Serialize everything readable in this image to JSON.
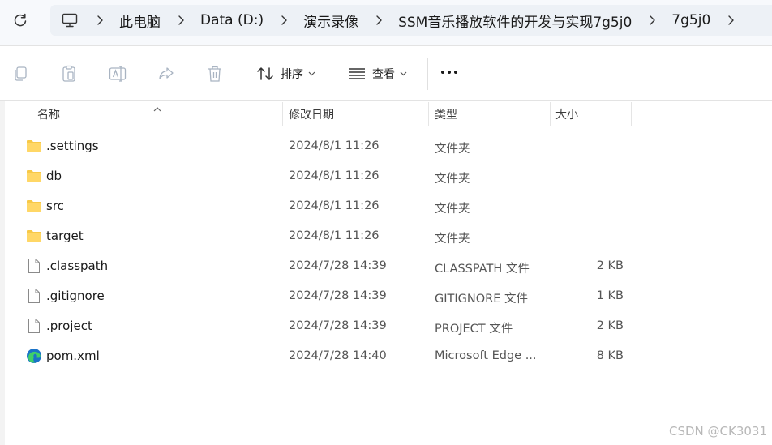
{
  "breadcrumb": {
    "items": [
      "此电脑",
      "Data (D:)",
      "演示录像",
      "SSM音乐播放软件的开发与实现7g5j0",
      "7g5j0"
    ]
  },
  "toolbar": {
    "sort_label": "排序",
    "view_label": "查看"
  },
  "columns": {
    "name": "名称",
    "date": "修改日期",
    "type": "类型",
    "size": "大小"
  },
  "files": [
    {
      "name": ".settings",
      "date": "2024/8/1 11:26",
      "type": "文件夹",
      "size": "",
      "icon": "folder-icon"
    },
    {
      "name": "db",
      "date": "2024/8/1 11:26",
      "type": "文件夹",
      "size": "",
      "icon": "folder-icon"
    },
    {
      "name": "src",
      "date": "2024/8/1 11:26",
      "type": "文件夹",
      "size": "",
      "icon": "folder-icon"
    },
    {
      "name": "target",
      "date": "2024/8/1 11:26",
      "type": "文件夹",
      "size": "",
      "icon": "folder-icon"
    },
    {
      "name": ".classpath",
      "date": "2024/7/28 14:39",
      "type": "CLASSPATH 文件",
      "size": "2 KB",
      "icon": "file-icon"
    },
    {
      "name": ".gitignore",
      "date": "2024/7/28 14:39",
      "type": "GITIGNORE 文件",
      "size": "1 KB",
      "icon": "file-icon"
    },
    {
      "name": ".project",
      "date": "2024/7/28 14:39",
      "type": "PROJECT 文件",
      "size": "2 KB",
      "icon": "file-icon"
    },
    {
      "name": "pom.xml",
      "date": "2024/7/28 14:40",
      "type": "Microsoft Edge ...",
      "size": "8 KB",
      "icon": "edge-icon"
    }
  ],
  "watermark": "CSDN @CK3031",
  "colors": {
    "folder": "#f7c948",
    "edge_blue": "#1a73c8",
    "edge_green": "#3ecf6a"
  }
}
